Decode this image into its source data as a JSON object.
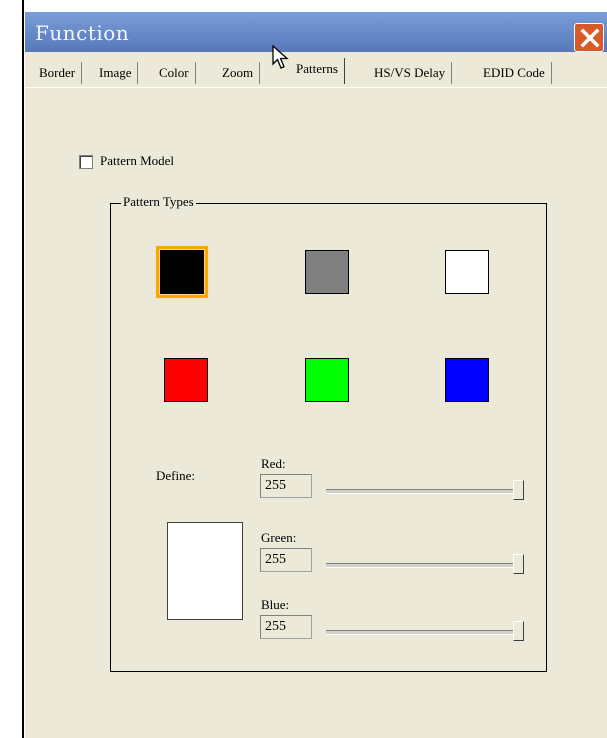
{
  "window": {
    "title": "Function"
  },
  "tabs": [
    {
      "label": "Border"
    },
    {
      "label": "Image"
    },
    {
      "label": "Color"
    },
    {
      "label": "Zoom"
    },
    {
      "label": "Patterns",
      "active": true
    },
    {
      "label": "HS/VS Delay"
    },
    {
      "label": "EDID Code"
    }
  ],
  "pattern_model": {
    "label": "Pattern Model",
    "checked": false
  },
  "pattern_types": {
    "legend": "Pattern Types",
    "swatches": [
      {
        "name": "black",
        "color": "#000000",
        "selected": true
      },
      {
        "name": "gray",
        "color": "#808080"
      },
      {
        "name": "white",
        "color": "#ffffff"
      },
      {
        "name": "red",
        "color": "#ff0000"
      },
      {
        "name": "green",
        "color": "#00ff00"
      },
      {
        "name": "blue",
        "color": "#0000ff"
      }
    ]
  },
  "define": {
    "label": "Define:",
    "preview_color": "#ffffff",
    "red": {
      "label": "Red:",
      "value": "255",
      "max": 255
    },
    "green": {
      "label": "Green:",
      "value": "255",
      "max": 255
    },
    "blue": {
      "label": "Blue:",
      "value": "255",
      "max": 255
    }
  }
}
